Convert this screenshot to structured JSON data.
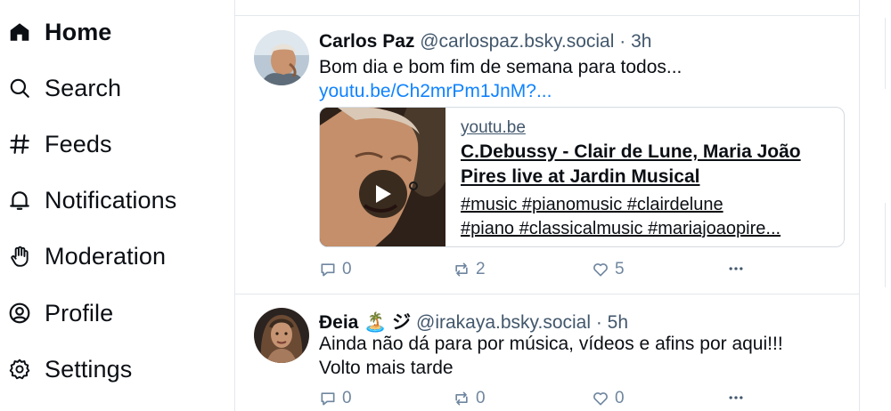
{
  "sidebar": {
    "items": [
      {
        "label": "Home",
        "icon": "home-icon",
        "active": true
      },
      {
        "label": "Search",
        "icon": "search-icon"
      },
      {
        "label": "Feeds",
        "icon": "hash-icon"
      },
      {
        "label": "Notifications",
        "icon": "bell-icon"
      },
      {
        "label": "Moderation",
        "icon": "hand-icon"
      },
      {
        "label": "Profile",
        "icon": "user-circle-icon"
      },
      {
        "label": "Settings",
        "icon": "gear-icon"
      }
    ]
  },
  "posts": [
    {
      "author": "Carlos Paz",
      "handle": "@carlospaz.bsky.social · 3h",
      "text": "Bom dia e bom fim de semana para todos...",
      "link": "youtu.be/Ch2mrPm1JnM?...",
      "embed": {
        "domain": "youtu.be",
        "title_line1": "C.Debussy - Clair de Lune, Maria João",
        "title_line2": "Pires live at Jardin Musical",
        "desc_line1": "#music #pianomusic #clairdelune",
        "desc_line2": "#piano #classicalmusic #mariajoaopire..."
      },
      "replies": "0",
      "reposts": "2",
      "likes": "5"
    },
    {
      "author": "Ðeia 🏝️ ジ",
      "handle": "@irakaya.bsky.social · 5h",
      "text_line1": "Ainda não dá para por música, vídeos e afins por aqui!!!",
      "text_line2": "Volto mais tarde",
      "replies": "0",
      "reposts": "0",
      "likes": "0"
    }
  ],
  "colors": {
    "accent": "#1083fe",
    "text": "#0b0f14",
    "muted": "#42576c",
    "action": "#6f869f",
    "border": "#e3e8ed"
  }
}
